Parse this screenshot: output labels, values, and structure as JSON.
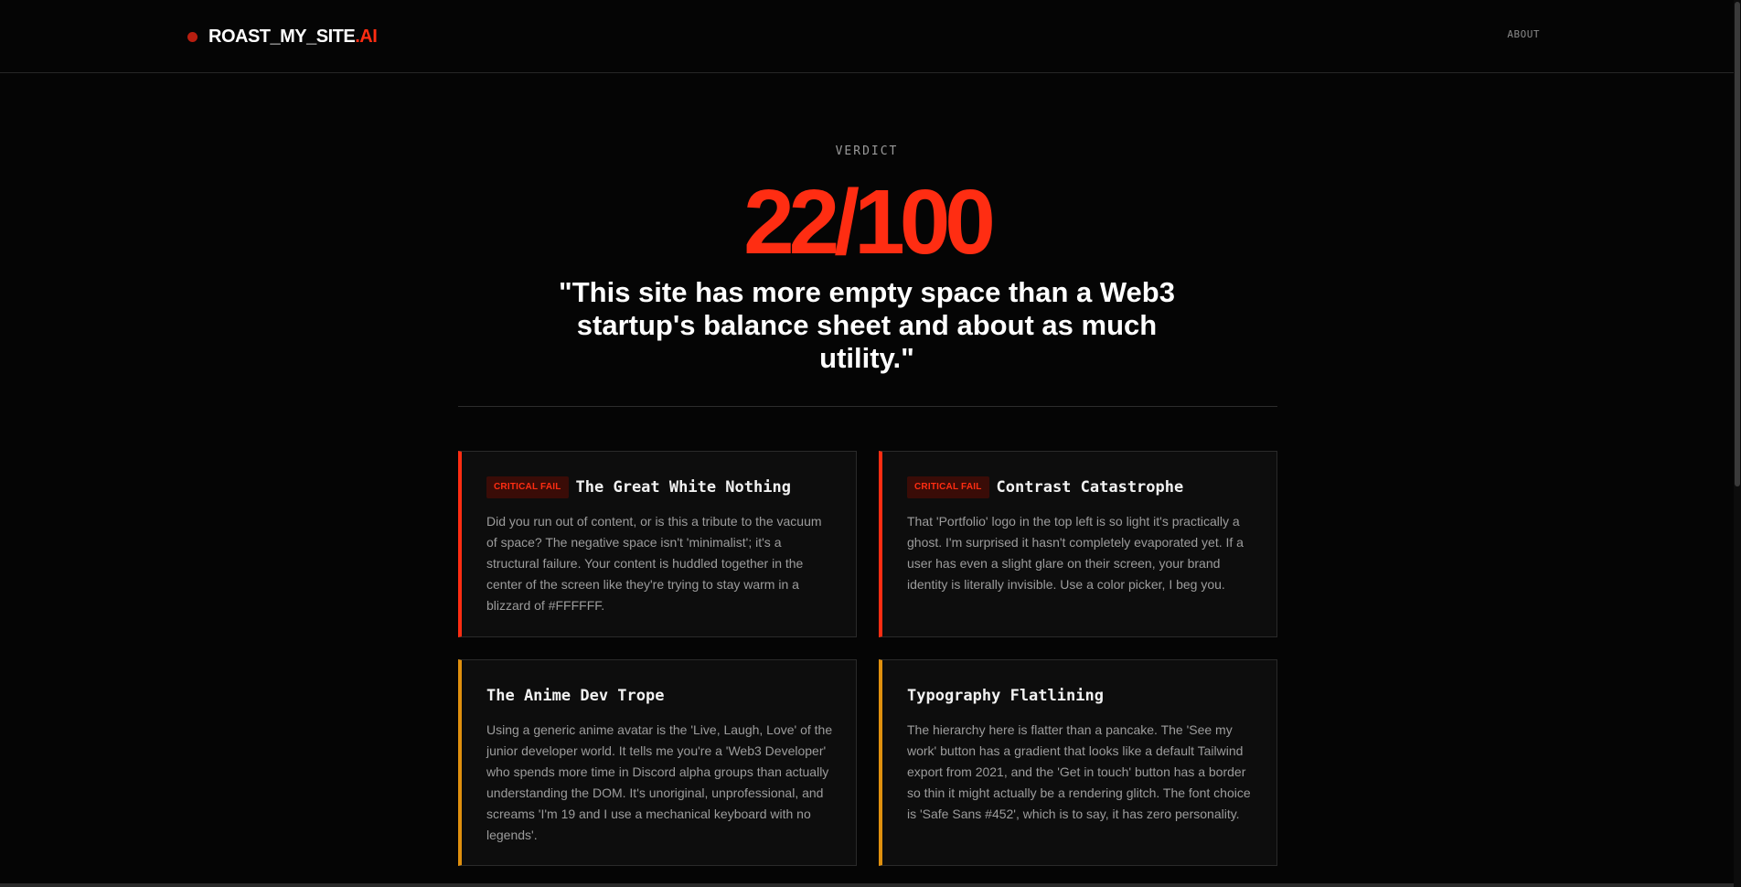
{
  "header": {
    "logo_main": "ROAST_MY_SITE",
    "logo_accent": ".AI",
    "nav_about": "ABOUT"
  },
  "verdict": {
    "label": "VERDICT",
    "score": "22/100",
    "quote": "\"This site has more empty space than a Web3 startup's balance sheet and about as much utility.\""
  },
  "cards": [
    {
      "badge": "CRITICAL FAIL",
      "title": "The Great White Nothing",
      "body": "Did you run out of content, or is this a tribute to the vacuum of space? The negative space isn't 'minimalist'; it's a structural failure. Your content is huddled together in the center of the screen like they're trying to stay warm in a blizzard of #FFFFFF."
    },
    {
      "badge": "CRITICAL FAIL",
      "title": "Contrast Catastrophe",
      "body": "That 'Portfolio' logo in the top left is so light it's practically a ghost. I'm surprised it hasn't completely evaporated yet. If a user has even a slight glare on their screen, your brand identity is literally invisible. Use a color picker, I beg you."
    },
    {
      "badge": "",
      "title": "The Anime Dev Trope",
      "body": "Using a generic anime avatar is the 'Live, Laugh, Love' of the junior developer world. It tells me you're a 'Web3 Developer' who spends more time in Discord alpha groups than actually understanding the DOM. It's unoriginal, unprofessional, and screams 'I'm 19 and I use a mechanical keyboard with no legends'."
    },
    {
      "badge": "",
      "title": "Typography Flatlining",
      "body": "The hierarchy here is flatter than a pancake. The 'See my work' button has a gradient that looks like a default Tailwind export from 2021, and the 'Get in touch' button has a border so thin it might actually be a rendering glitch. The font choice is 'Safe Sans #452', which is to say, it has zero personality."
    }
  ],
  "colors": {
    "accent": "#ff2d12",
    "warning": "#e0900e",
    "background": "#050505"
  }
}
